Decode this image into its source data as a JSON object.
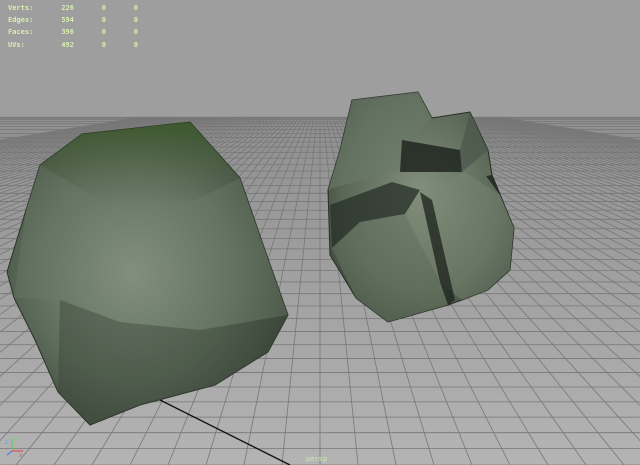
{
  "hud": {
    "rows": [
      {
        "label": "Verts:",
        "values": [
          "226",
          "0",
          "0"
        ]
      },
      {
        "label": "Edges:",
        "values": [
          "594",
          "0",
          "0"
        ]
      },
      {
        "label": "Faces:",
        "values": [
          "396",
          "0",
          "0"
        ]
      },
      {
        "label": "UVs:",
        "values": [
          "492",
          "0",
          "0"
        ]
      }
    ]
  },
  "camera": {
    "label": "persp"
  },
  "axis": {
    "z": "z",
    "y": "y",
    "x": "x"
  },
  "colors": {
    "sky": "#9e9e9e",
    "floor": "#a4a4a4",
    "grid": "#7c7c7c",
    "hud_text": "#d8efb0",
    "rock": "#5b6a5a"
  }
}
